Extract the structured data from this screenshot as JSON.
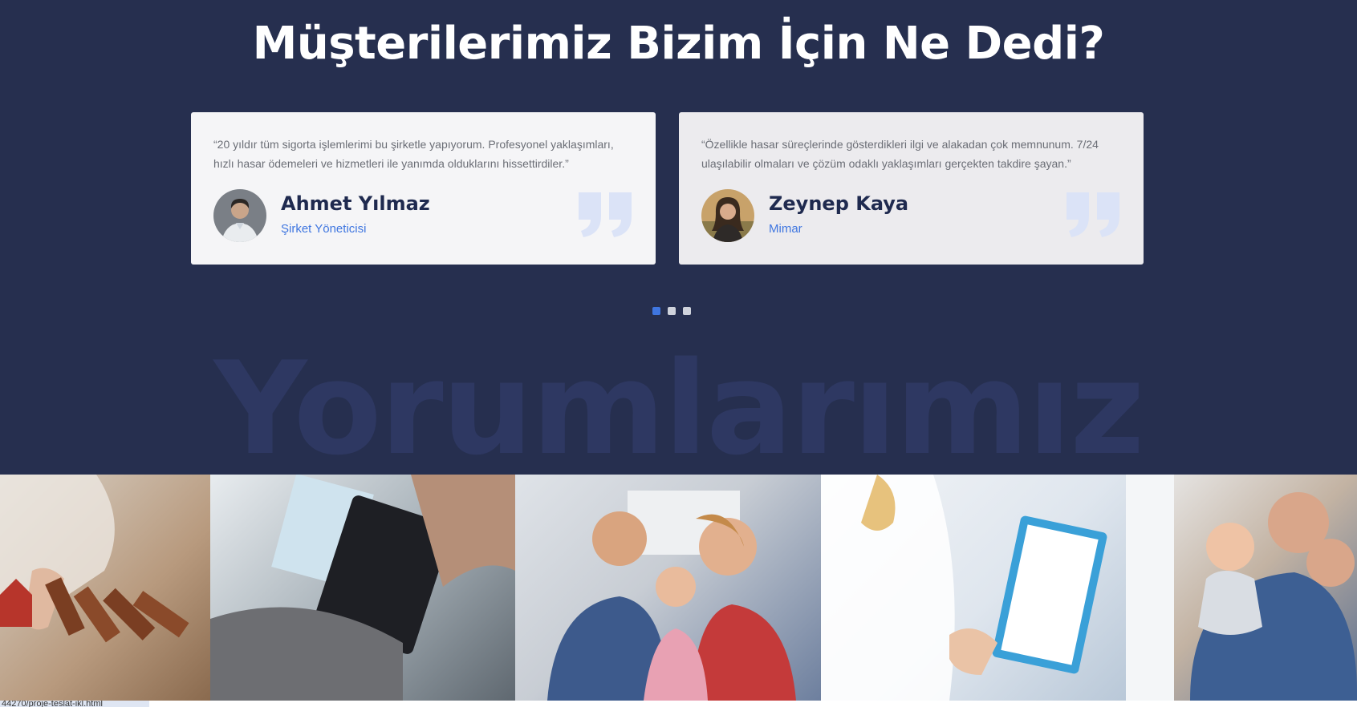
{
  "section": {
    "title": "Müşterilerimiz Bizim İçin Ne Dedi?",
    "watermark": "Yorumlarımız"
  },
  "testimonials": [
    {
      "quote": "“20 yıldır tüm sigorta işlemlerimi bu şirketle yapıyorum. Profesyonel yaklaşımları, hızlı hasar ödemeleri ve hizmetleri ile yanımda olduklarını hissettirdiler.”",
      "name": "Ahmet Yılmaz",
      "role": "Şirket Yöneticisi"
    },
    {
      "quote": "“Özellikle hasar süreçlerinde gösterdikleri ilgi ve alakadan çok memnunum. 7/24 ulaşılabilir olmaları ve çözüm odaklı yaklaşımları gerçekten takdire şayan.”",
      "name": "Zeynep Kaya",
      "role": "Mimar"
    }
  ],
  "carousel": {
    "active_index": 0,
    "dot_count": 3
  },
  "colors": {
    "background": "#262f4f",
    "accent": "#3f76e0",
    "name": "#1f2a4f",
    "quote_mark": "#dbe3f7"
  },
  "statusbar": {
    "text": "44270/proje-teslat-ikl.html"
  }
}
